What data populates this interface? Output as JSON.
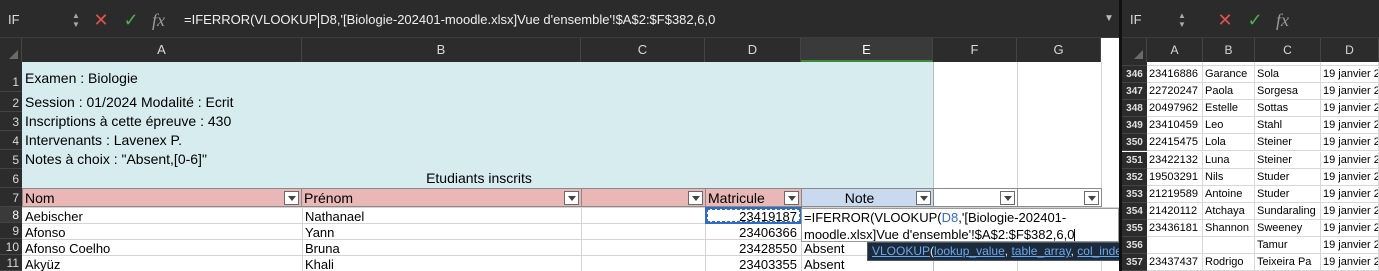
{
  "left": {
    "name_box": "IF",
    "formula": {
      "before_caret": "=IFERROR(VLOOKUP",
      "after_caret": "D8,'[Biologie-202401-moodle.xlsx]Vue d'ensemble'!$A$2:$F$382,6,0"
    },
    "icons": {
      "cancel": "close-icon",
      "confirm": "check-icon",
      "function": "fx-icon"
    },
    "colors": {
      "band": "#d6ecef",
      "header_pink": "#e9b7b6",
      "header_blue": "#c9d9ee",
      "selection": "#2f6cc6"
    },
    "columns": [
      "A",
      "B",
      "C",
      "D",
      "E",
      "F",
      "G"
    ],
    "rows": [
      "1",
      "2",
      "3",
      "4",
      "5",
      "6",
      "7",
      "8",
      "9",
      "10",
      "11"
    ],
    "info": [
      "Examen : Biologie",
      "Session : 01/2024 Modalité : Ecrit",
      "Inscriptions à cette épreuve : 430",
      "Intervenants : Lavenex P.",
      "Notes à choix : \"Absent,[0-6]\""
    ],
    "section_title": "Etudiants inscrits",
    "table_headers": {
      "nom": "Nom",
      "prenom": "Prénom",
      "matricule": "Matricule",
      "note": "Note"
    },
    "students": [
      {
        "nom": "Aebischer",
        "prenom": "Nathanael",
        "matricule": "23419187",
        "note": ""
      },
      {
        "nom": "Afonso",
        "prenom": "Yann",
        "matricule": "23406366",
        "note": ""
      },
      {
        "nom": "Afonso Coelho",
        "prenom": "Bruna",
        "matricule": "23428550",
        "note": "Absent"
      },
      {
        "nom": "Akyüz",
        "prenom": "Khali",
        "matricule": "23403355",
        "note": "Absent"
      }
    ],
    "editor": {
      "line1_a": "=IFERROR(VLOOKUP(",
      "line1_ref": "D8",
      "line1_b": ",'[Biologie-202401-",
      "line2": "moodle.xlsx]Vue d'ensemble'!$A$2:$F$382,6,0"
    },
    "tooltip": {
      "fn": "VLOOKUP",
      "open": "(",
      "a1": "lookup_value",
      "sep": ", ",
      "a2": "table_array",
      "a3": "col_index_num",
      "opt_open": "[",
      "a4": "range_lookup",
      "opt_close": "]",
      "close": ")"
    }
  },
  "right": {
    "name_box": "IF",
    "columns": [
      "A",
      "B",
      "C",
      "D"
    ],
    "rows": [
      {
        "n": "346",
        "a": "23416886",
        "b": "Garance",
        "c": "Sola",
        "d": "19 janvier 2"
      },
      {
        "n": "347",
        "a": "22720247",
        "b": "Paola",
        "c": "Sorgesa",
        "d": "19 janvier 2"
      },
      {
        "n": "348",
        "a": "20497962",
        "b": "Estelle",
        "c": "Sottas",
        "d": "19 janvier 2"
      },
      {
        "n": "349",
        "a": "23410459",
        "b": "Leo",
        "c": "Stahl",
        "d": "19 janvier 2"
      },
      {
        "n": "350",
        "a": "22415475",
        "b": "Lola",
        "c": "Steiner",
        "d": "19 janvier 2"
      },
      {
        "n": "351",
        "a": "23422132",
        "b": "Luna",
        "c": "Steiner",
        "d": "19 janvier 2"
      },
      {
        "n": "352",
        "a": "19503291",
        "b": "Nils",
        "c": "Studer",
        "d": "19 janvier 2"
      },
      {
        "n": "353",
        "a": "21219589",
        "b": "Antoine",
        "c": "Studer",
        "d": "19 janvier 2"
      },
      {
        "n": "354",
        "a": "21420112",
        "b": "Atchaya",
        "c": "Sundaraling",
        "d": "19 janvier 2"
      },
      {
        "n": "355",
        "a": "23436181",
        "b": "Shannon",
        "c": "Sweeney",
        "d": "19 janvier 2"
      },
      {
        "n": "356",
        "a": "",
        "b": "",
        "c": "Tamur",
        "d": "19 janvier 2"
      },
      {
        "n": "357",
        "a": "23437437",
        "b": "Rodrigo",
        "c": "Teixeira Pa",
        "d": "19 janvier 2"
      }
    ]
  }
}
